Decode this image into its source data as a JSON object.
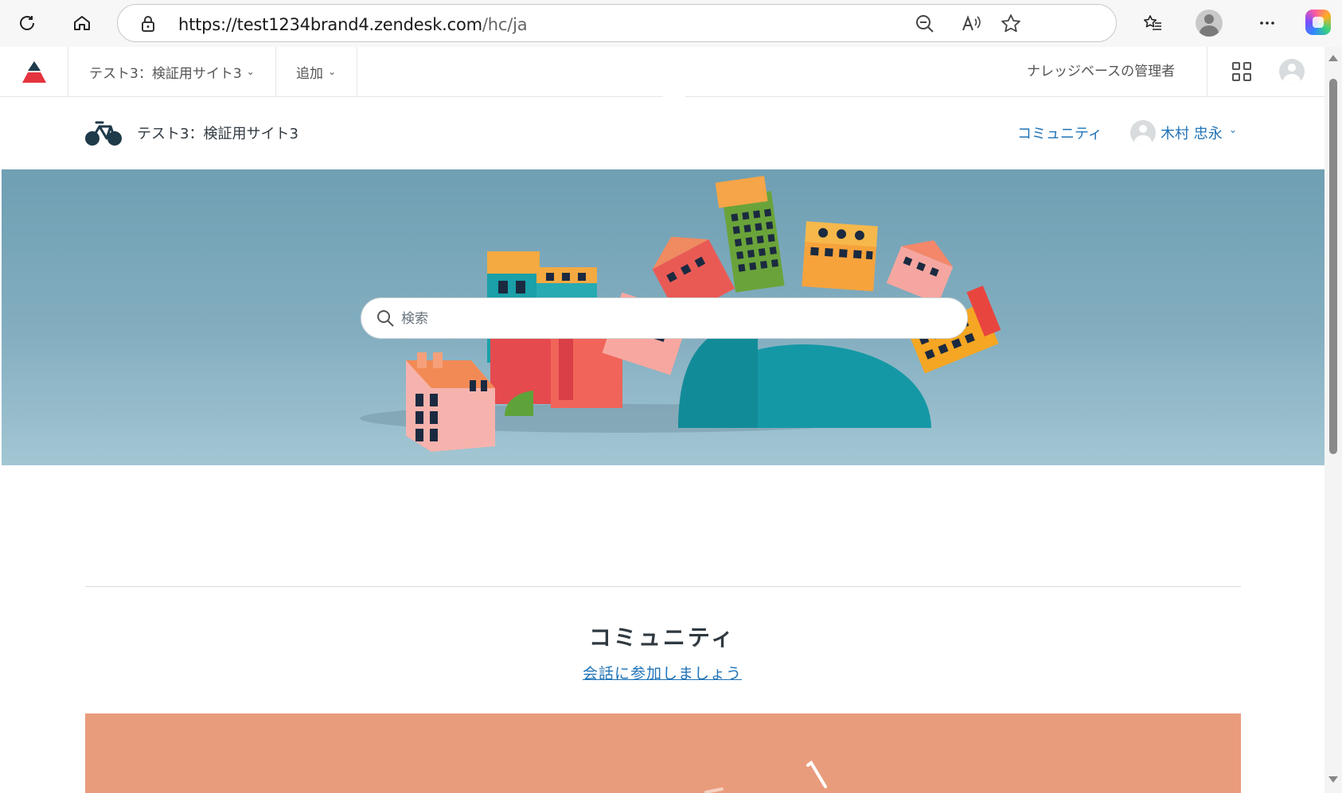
{
  "browser": {
    "url_main": "https://test1234brand4.zendesk.com",
    "url_path": "/hc/ja",
    "icons": [
      "refresh-icon",
      "home-icon",
      "lock-icon",
      "zoom-out-icon",
      "read-aloud-icon",
      "favorite-icon",
      "favorites-list-icon",
      "profile-icon",
      "more-icon",
      "copilot-icon"
    ]
  },
  "admin_bar": {
    "brand_menu": "テスト3：検証用サイト3",
    "add_menu": "追加",
    "role_label": "ナレッジベースの管理者"
  },
  "header": {
    "brand_name": "テスト3：検証用サイト3",
    "nav_community": "コミュニティ",
    "user_name": "木村 忠永"
  },
  "hero": {
    "search_placeholder": "検索"
  },
  "community_section": {
    "title": "コミュニティ",
    "link": "会話に参加しましょう"
  },
  "colors": {
    "link": "#1f73b7",
    "text": "#2f3941",
    "hero_bg": "#7aa7ba",
    "banner": "#e99c7c"
  }
}
